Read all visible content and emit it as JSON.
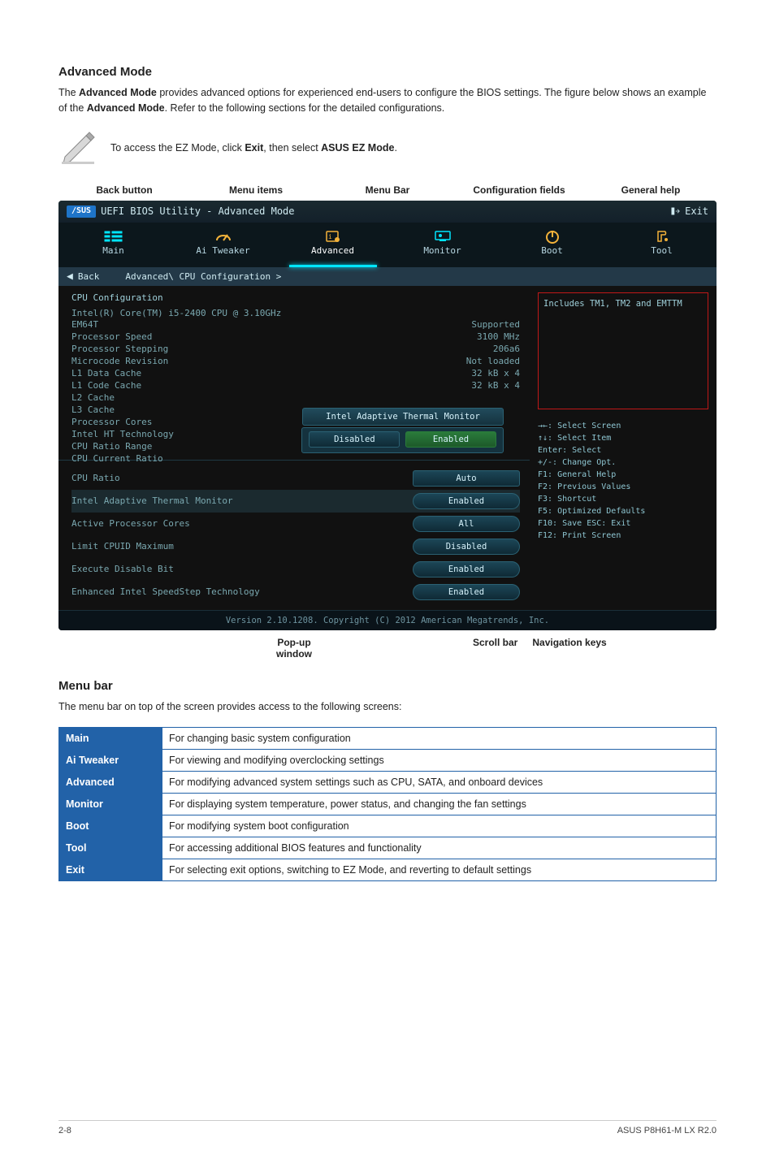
{
  "section1_title": "Advanced Mode",
  "section1_body_1": "The ",
  "section1_body_bold1": "Advanced Mode",
  "section1_body_2": " provides advanced options for experienced end-users to configure the BIOS settings. The figure below shows an example of the ",
  "section1_body_bold2": "Advanced Mode",
  "section1_body_3": ". Refer to the following sections for the detailed configurations.",
  "note_pre": "To access the EZ Mode, click ",
  "note_bold1": "Exit",
  "note_mid": ", then select ",
  "note_bold2": "ASUS EZ Mode",
  "note_end": ".",
  "top_labels": {
    "back": "Back button",
    "menu_items": "Menu items",
    "menu_bar": "Menu Bar",
    "config": "Configuration fields",
    "help": "General help"
  },
  "bios": {
    "title": "UEFI BIOS Utility - Advanced Mode",
    "brand": "/SUS",
    "exit": "Exit",
    "tabs": [
      "Main",
      "Ai Tweaker",
      "Advanced",
      "Monitor",
      "Boot",
      "Tool"
    ],
    "active_tab": 2,
    "back_label": "Back",
    "breadcrumb": "Advanced\\ CPU Configuration >",
    "header": "CPU Configuration",
    "cpu_line": "Intel(R) Core(TM) i5-2400 CPU @ 3.10GHz",
    "info": [
      {
        "k": "EM64T",
        "v": "Supported"
      },
      {
        "k": "Processor Speed",
        "v": "3100 MHz"
      },
      {
        "k": "Processor Stepping",
        "v": "206a6"
      },
      {
        "k": "Microcode Revision",
        "v": "Not loaded"
      },
      {
        "k": "L1 Data Cache",
        "v": "32 kB x 4"
      },
      {
        "k": "L1 Code Cache",
        "v": "32 kB x 4"
      },
      {
        "k": "L2 Cache",
        "v": ""
      },
      {
        "k": "L3 Cache",
        "v": ""
      },
      {
        "k": "Processor Cores",
        "v": ""
      },
      {
        "k": "Intel HT Technology",
        "v": ""
      },
      {
        "k": "CPU Ratio Range",
        "v": ""
      },
      {
        "k": "CPU Current Ratio",
        "v": ""
      }
    ],
    "popup_label": "Intel Adaptive Thermal Monitor",
    "popup_options": [
      "Disabled",
      "Enabled"
    ],
    "settings": [
      {
        "k": "CPU Ratio",
        "v": "Auto",
        "pillClass": "square"
      },
      {
        "k": "Intel Adaptive Thermal Monitor",
        "v": "Enabled",
        "selected": true
      },
      {
        "k": "Active Processor Cores",
        "v": "All"
      },
      {
        "k": "Limit CPUID Maximum",
        "v": "Disabled"
      },
      {
        "k": "Execute Disable Bit",
        "v": "Enabled"
      },
      {
        "k": "Enhanced Intel SpeedStep Technology",
        "v": "Enabled"
      }
    ],
    "right_help": "Includes TM1, TM2 and EMTTM",
    "keys": [
      "→←: Select Screen",
      "↑↓: Select Item",
      "Enter: Select",
      "+/-: Change Opt.",
      "F1: General Help",
      "F2: Previous Values",
      "F3: Shortcut",
      "F5: Optimized Defaults",
      "F10: Save  ESC: Exit",
      "F12: Print Screen"
    ],
    "footer": "Version 2.10.1208. Copyright (C) 2012 American Megatrends, Inc."
  },
  "under_labels": {
    "popup": "Pop-up",
    "popup2": "window",
    "scroll": "Scroll bar",
    "nav": "Navigation keys"
  },
  "section2_title": "Menu bar",
  "section2_body": "The menu bar on top of the screen provides access to the following screens:",
  "table": [
    {
      "h": "Main",
      "d": "For changing basic system configuration"
    },
    {
      "h": "Ai Tweaker",
      "d": "For viewing and modifying overclocking settings"
    },
    {
      "h": "Advanced",
      "d": "For modifying advanced system settings such as CPU, SATA, and onboard devices"
    },
    {
      "h": "Monitor",
      "d": "For displaying system temperature, power status, and changing the fan settings"
    },
    {
      "h": "Boot",
      "d": "For modifying system boot configuration"
    },
    {
      "h": "Tool",
      "d": "For accessing additional BIOS features and functionality"
    },
    {
      "h": "Exit",
      "d": "For selecting exit options, switching to EZ Mode, and reverting to default settings"
    }
  ],
  "footer_left": "2-8",
  "footer_right": "ASUS P8H61-M LX R2.0"
}
